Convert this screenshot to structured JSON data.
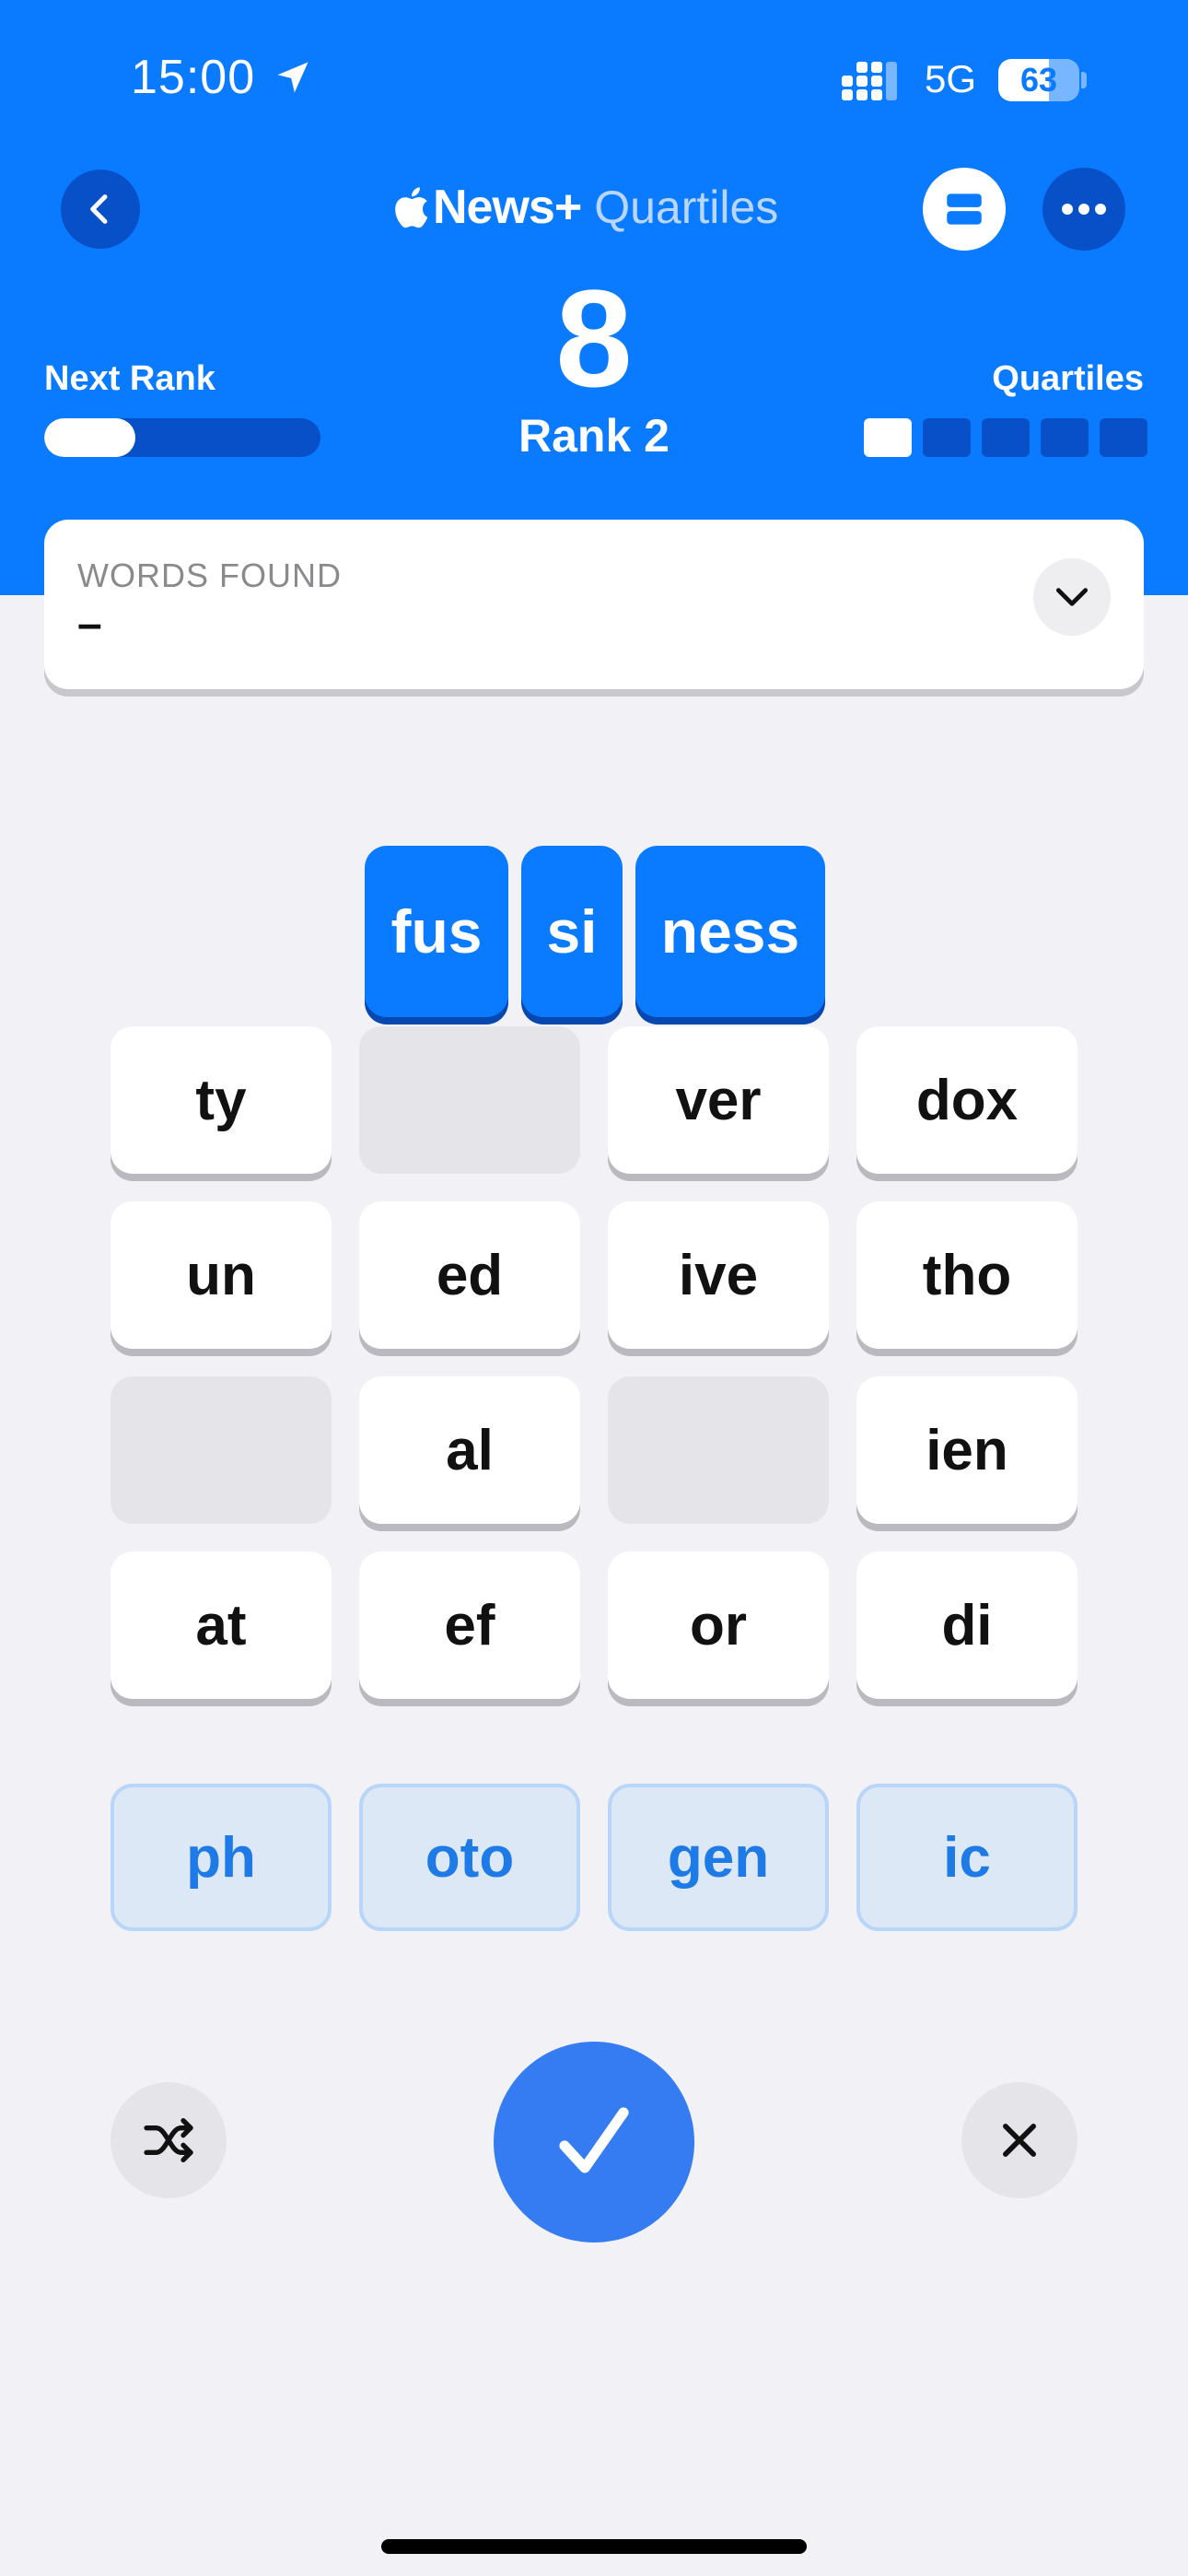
{
  "status_bar": {
    "time": "15:00",
    "network": "5G",
    "battery_percent": "63",
    "battery_level": 0.63
  },
  "nav": {
    "brand_name": "News+",
    "game_name": "Quartiles",
    "back_icon": "chevron-left-icon",
    "cards_icon": "cards-icon",
    "more_icon": "ellipsis-icon"
  },
  "score": {
    "points": "8",
    "rank": "Rank 2",
    "next_rank_label": "Next Rank",
    "next_rank_progress": 0.33,
    "quartiles_label": "Quartiles",
    "quartiles_found": 1,
    "quartiles_total": 5
  },
  "words_found": {
    "label": "WORDS FOUND",
    "value": "–"
  },
  "selected_tiles": [
    "fus",
    "si",
    "ness"
  ],
  "grid_tiles": [
    "ty",
    "",
    "ver",
    "dox",
    "un",
    "ed",
    "ive",
    "tho",
    "",
    "al",
    "",
    "ien",
    "at",
    "ef",
    "or",
    "di"
  ],
  "quartile_tiles": [
    "ph",
    "oto",
    "gen",
    "ic"
  ],
  "colors": {
    "accent": "#0a7aff",
    "accent_dark": "#0850c8",
    "submit": "#357cf2",
    "background": "#f1f1f6"
  }
}
